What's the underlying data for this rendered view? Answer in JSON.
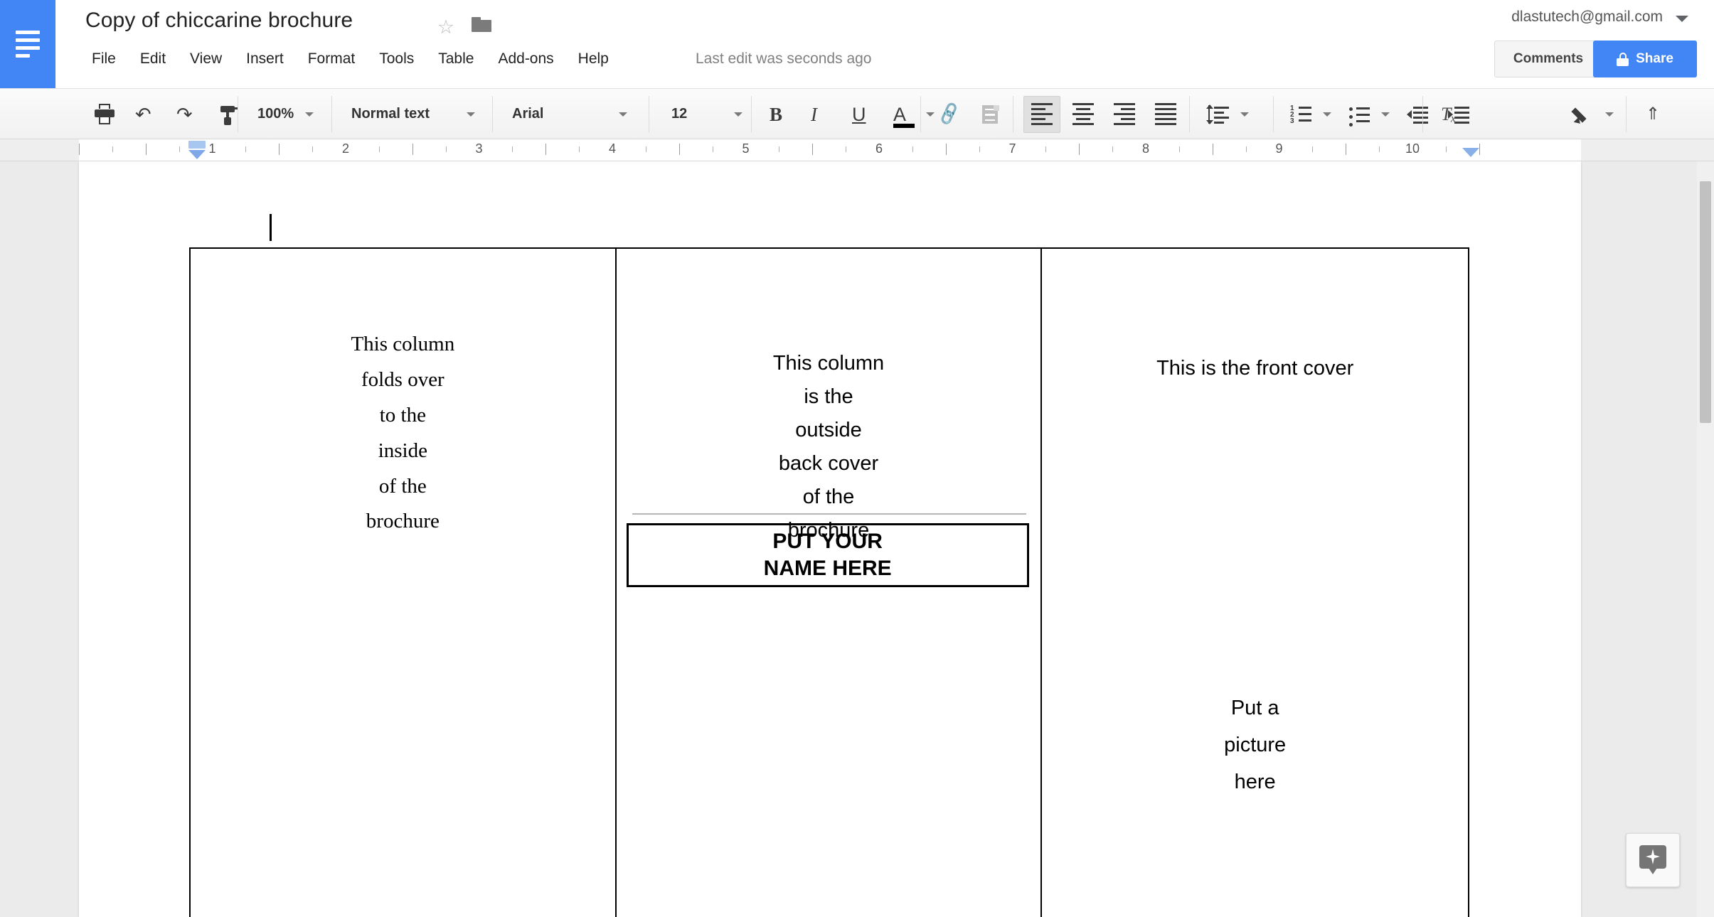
{
  "app": {
    "logo_icon": "docs-lines-icon",
    "doc_title": "Copy of chiccarine brochure",
    "star_icon": "star-outline-icon",
    "folder_icon": "folder-icon",
    "last_edit": "Last edit was seconds ago",
    "account_email": "dlastutech@gmail.com",
    "comments_label": "Comments",
    "share_label": "Share",
    "share_lock_icon": "lock-icon",
    "account_caret_icon": "chevron-down-icon"
  },
  "menubar": {
    "items": [
      {
        "label": "File"
      },
      {
        "label": "Edit"
      },
      {
        "label": "View"
      },
      {
        "label": "Insert"
      },
      {
        "label": "Format"
      },
      {
        "label": "Tools"
      },
      {
        "label": "Table"
      },
      {
        "label": "Add-ons"
      },
      {
        "label": "Help"
      }
    ]
  },
  "toolbar": {
    "print_icon": "print-icon",
    "undo_icon": "undo-icon",
    "redo_icon": "redo-icon",
    "paint_format_icon": "paint-format-icon",
    "zoom_value": "100%",
    "style_value": "Normal text",
    "font_value": "Arial",
    "font_size_value": "12",
    "bold_label": "B",
    "italic_label": "I",
    "underline_label": "U",
    "text_color_label": "A",
    "link_icon": "link-icon",
    "comment_icon": "add-comment-icon",
    "align_left_icon": "align-left-icon",
    "align_center_icon": "align-center-icon",
    "align_right_icon": "align-right-icon",
    "align_justify_icon": "align-justify-icon",
    "line_spacing_icon": "line-spacing-icon",
    "numbered_list_icon": "numbered-list-icon",
    "bulleted_list_icon": "bulleted-list-icon",
    "decrease_indent_icon": "decrease-indent-icon",
    "increase_indent_icon": "increase-indent-icon",
    "clear_formatting_icon": "clear-formatting-icon",
    "edit_mode_icon": "pencil-icon",
    "collapse_toolbar_icon": "chevron-up-icon",
    "active_alignment": "align-left"
  },
  "ruler": {
    "numbers": [
      "1",
      "2",
      "3",
      "4",
      "5",
      "6",
      "7",
      "8",
      "9",
      "10"
    ],
    "left_indent_inches": 0.5,
    "right_indent_inches": 9.45
  },
  "document": {
    "columns": [
      {
        "name": "inside-fold-column",
        "text": "This column folds over to the inside of the brochure",
        "lines": [
          "This column",
          "folds over",
          "to the",
          "inside",
          "of the",
          "brochure"
        ],
        "font": "serif"
      },
      {
        "name": "back-cover-column",
        "text": "This column is the outside back cover of the brochure",
        "lines": [
          "This column",
          "is the",
          "outside",
          "back cover",
          "of the",
          "brochure"
        ],
        "font": "sans",
        "name_box_lines": [
          "PUT YOUR",
          "NAME HERE"
        ]
      },
      {
        "name": "front-cover-column",
        "title": "This is the front cover",
        "picture_lines": [
          "Put a",
          "picture",
          "here"
        ],
        "font": "sans"
      }
    ]
  },
  "explore": {
    "icon": "explore-sparkle-icon"
  }
}
